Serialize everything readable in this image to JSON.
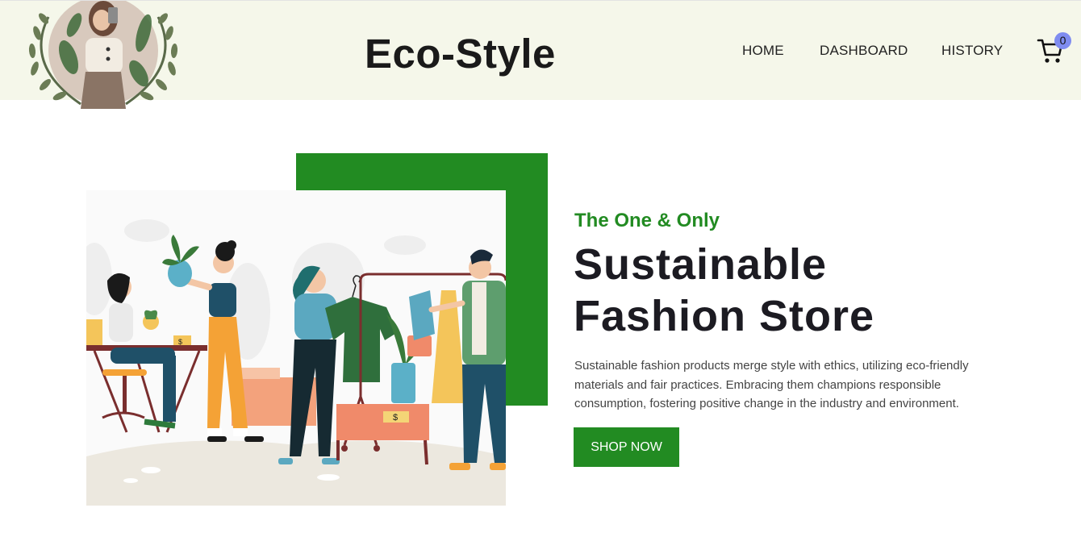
{
  "header": {
    "brand": "Eco-Style",
    "nav": [
      {
        "label": "HOME"
      },
      {
        "label": "DASHBOARD"
      },
      {
        "label": "HISTORY"
      }
    ],
    "cart": {
      "icon": "cart-icon",
      "count": "0"
    }
  },
  "hero": {
    "tagline": "The One & Only",
    "title_line1": "Sustainable",
    "title_line2": "Fashion Store",
    "description": "Sustainable fashion products merge style with ethics, utilizing eco-friendly materials and fair practices. Embracing them champions responsible consumption, fostering positive change in the industry and environment.",
    "cta": "SHOP NOW"
  },
  "colors": {
    "accent": "#228b22",
    "header_bg": "#f5f7ea",
    "badge": "#7f8cf0"
  }
}
